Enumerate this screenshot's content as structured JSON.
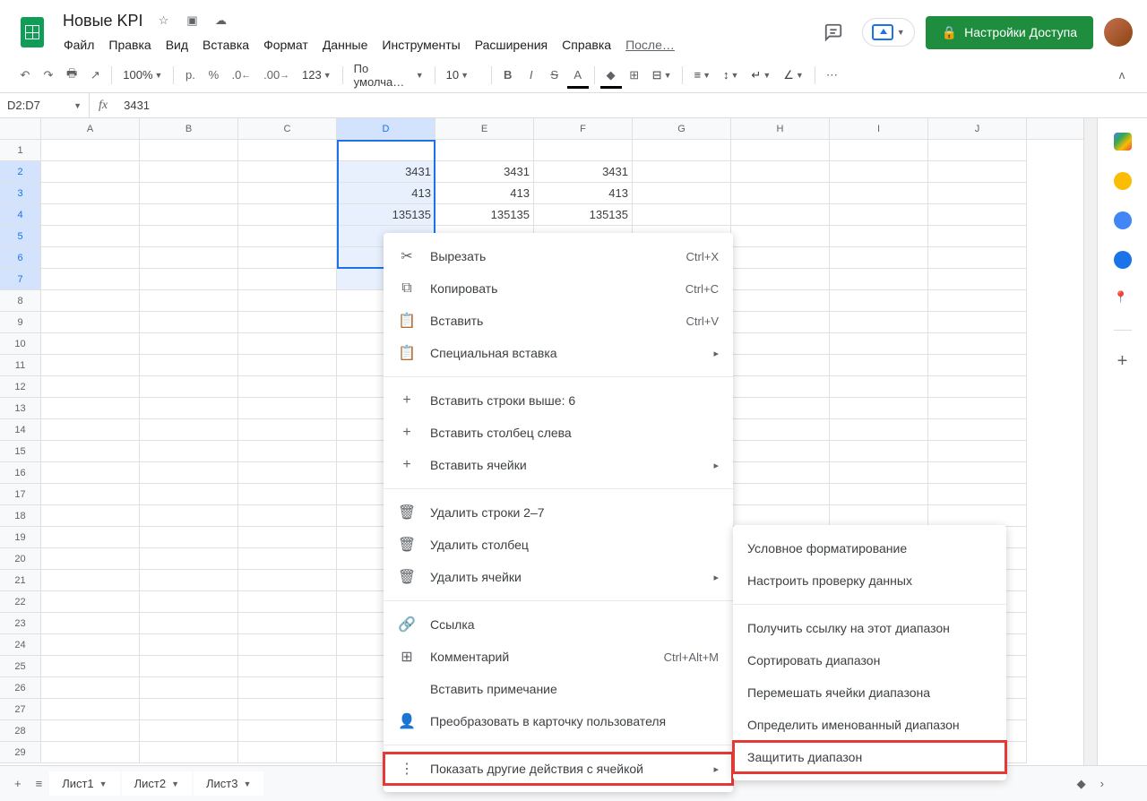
{
  "title": "Новые KPI",
  "menubar": [
    "Файл",
    "Правка",
    "Вид",
    "Вставка",
    "Формат",
    "Данные",
    "Инструменты",
    "Расширения",
    "Справка"
  ],
  "last_edit": "После…",
  "share_label": "Настройки Доступа",
  "toolbar": {
    "zoom": "100%",
    "currency": "р.",
    "percent": "%",
    "dec_dec": ".0",
    "inc_dec": ".00",
    "num_fmt": "123",
    "font": "По умолча…",
    "font_size": "10"
  },
  "name_box": "D2:D7",
  "formula": "3431",
  "columns": [
    "A",
    "B",
    "C",
    "D",
    "E",
    "F",
    "G",
    "H",
    "I",
    "J"
  ],
  "selected_col": "D",
  "selected_rows": [
    2,
    3,
    4,
    5,
    6,
    7
  ],
  "row_count": 29,
  "cells": {
    "D2": "3431",
    "E2": "3431",
    "F2": "3431",
    "D3": "413",
    "E3": "413",
    "F3": "413",
    "D4": "135135",
    "E4": "135135",
    "F4": "135135"
  },
  "context_menu": [
    {
      "icon": "✂",
      "label": "Вырезать",
      "shortcut": "Ctrl+X"
    },
    {
      "icon": "⧉",
      "label": "Копировать",
      "shortcut": "Ctrl+C"
    },
    {
      "icon": "📋",
      "label": "Вставить",
      "shortcut": "Ctrl+V"
    },
    {
      "icon": "📋",
      "label": "Специальная вставка",
      "arrow": true
    },
    {
      "sep": true
    },
    {
      "icon": "+",
      "label": "Вставить строки выше: 6"
    },
    {
      "icon": "+",
      "label": "Вставить столбец слева"
    },
    {
      "icon": "+",
      "label": "Вставить ячейки",
      "arrow": true
    },
    {
      "sep": true
    },
    {
      "icon": "🗑",
      "label": "Удалить строки 2–7"
    },
    {
      "icon": "🗑",
      "label": "Удалить столбец"
    },
    {
      "icon": "🗑",
      "label": "Удалить ячейки",
      "arrow": true
    },
    {
      "sep": true
    },
    {
      "icon": "🔗",
      "label": "Ссылка"
    },
    {
      "icon": "⊞",
      "label": "Комментарий",
      "shortcut": "Ctrl+Alt+M"
    },
    {
      "icon": "",
      "label": "Вставить примечание"
    },
    {
      "icon": "👤",
      "label": "Преобразовать в карточку пользователя"
    },
    {
      "sep": true
    },
    {
      "icon": "⋮",
      "label": "Показать другие действия с ячейкой",
      "arrow": true,
      "highlight": true
    }
  ],
  "submenu": [
    {
      "label": "Условное форматирование"
    },
    {
      "label": "Настроить проверку данных"
    },
    {
      "sep": true
    },
    {
      "label": "Получить ссылку на этот диапазон"
    },
    {
      "label": "Сортировать диапазон"
    },
    {
      "label": "Перемешать ячейки диапазона"
    },
    {
      "label": "Определить именованный диапазон"
    },
    {
      "label": "Защитить диапазон",
      "highlight": true
    }
  ],
  "sheets": [
    "Лист1",
    "Лист2",
    "Лист3"
  ]
}
